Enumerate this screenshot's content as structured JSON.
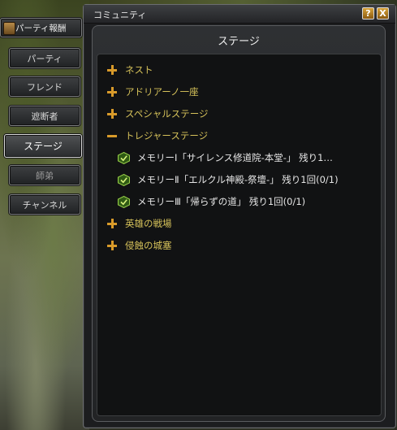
{
  "window": {
    "title": "コミュニティ",
    "help_label": "?",
    "close_label": "X",
    "panel_title": "ステージ"
  },
  "side_tabs": [
    {
      "label": "パーティ報酬"
    },
    {
      "label": "パーティ"
    },
    {
      "label": "フレンド"
    },
    {
      "label": "遮断者"
    },
    {
      "label": "ステージ"
    },
    {
      "label": "師弟"
    },
    {
      "label": "チャンネル"
    }
  ],
  "categories": {
    "nest": "ネスト",
    "adriano": "アドリアーノ一座",
    "special": "スペシャルステージ",
    "treasure": "トレジャーステージ",
    "battlefield": "英雄の戦場",
    "fortress": "侵蝕の城塞"
  },
  "stages": [
    {
      "label": "メモリーⅠ「サイレンス修道院-本堂-」  残り1…"
    },
    {
      "label": "メモリーⅡ「エルクル神殿-祭壇-」  残り1回(0/1)"
    },
    {
      "label": "メモリーⅢ「帰らずの道」  残り1回(0/1)"
    }
  ],
  "colors": {
    "category_text": "#d6c25a",
    "expander": "#d89a2a",
    "stage_icon": "#7fbf3a"
  },
  "icons": {
    "expander_collapsed": "plus-icon",
    "expander_expanded": "minus-icon",
    "stage": "stage-icon",
    "tab_top": "party-reward-icon"
  }
}
